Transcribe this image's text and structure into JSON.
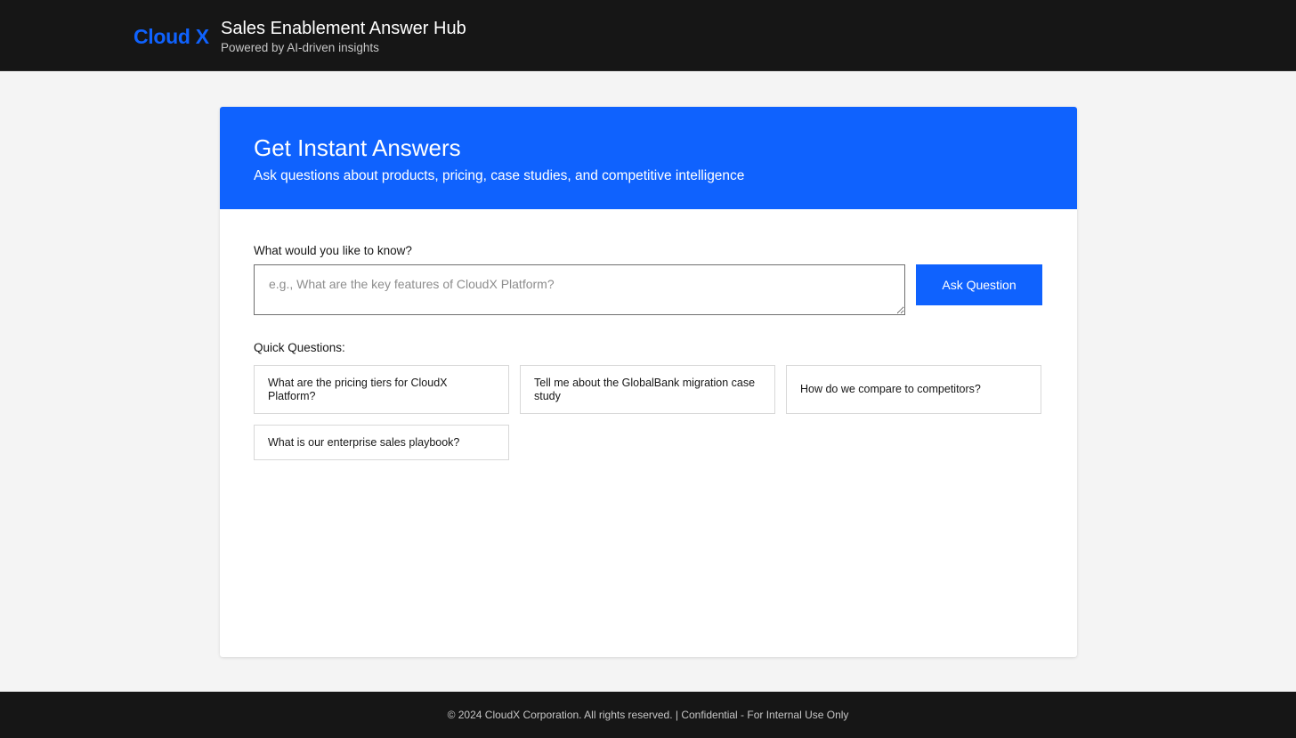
{
  "header": {
    "brand": "Cloud X",
    "title": "Sales Enablement Answer Hub",
    "subtitle": "Powered by AI-driven insights"
  },
  "hero": {
    "title": "Get Instant Answers",
    "subtitle": "Ask questions about products, pricing, case studies, and competitive intelligence"
  },
  "question": {
    "label": "What would you like to know?",
    "placeholder": "e.g., What are the key features of CloudX Platform?",
    "value": "",
    "button_label": "Ask Question"
  },
  "quick_questions": {
    "label": "Quick Questions:",
    "items": [
      "What are the pricing tiers for CloudX Platform?",
      "Tell me about the GlobalBank migration case study",
      "How do we compare to competitors?",
      "What is our enterprise sales playbook?"
    ]
  },
  "footer": {
    "text": "© 2024 CloudX Corporation. All rights reserved. | Confidential - For Internal Use Only"
  },
  "colors": {
    "brand": "#0f62fe",
    "header_bg": "#161616",
    "page_bg": "#f4f4f4"
  }
}
